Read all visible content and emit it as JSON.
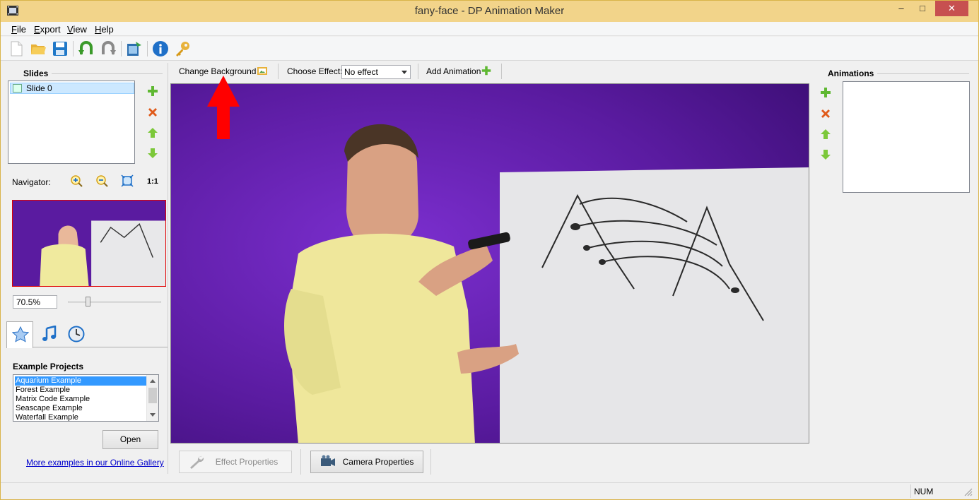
{
  "window": {
    "title": "fany-face - DP Animation Maker",
    "minimize": "–",
    "maximize": "□",
    "close": "✕"
  },
  "menu": [
    "File",
    "Export",
    "View",
    "Help"
  ],
  "toolbar": {
    "icons": [
      "new-file-icon",
      "open-folder-icon",
      "save-disk-icon",
      "undo-icon",
      "redo-icon",
      "export-video-icon",
      "info-icon",
      "key-icon"
    ]
  },
  "slides": {
    "title": "Slides",
    "items": [
      {
        "label": "Slide 0"
      }
    ]
  },
  "navigator": {
    "label": "Navigator:",
    "actual_size": "1:1",
    "zoom": "70.5%",
    "zoom_slider_percent": 25
  },
  "tabs": [
    "star-icon",
    "music-note-icon",
    "clock-icon"
  ],
  "examples": {
    "title": "Example Projects",
    "items": [
      "Aquarium Example",
      "Forest Example",
      "Matrix Code Example",
      "Seascape Example",
      "Waterfall Example"
    ],
    "selected": 0,
    "open_button": "Open",
    "gallery_link": "More examples in our Online Gallery"
  },
  "background_bar": {
    "change_background": "Change Background",
    "choose_effect_label": "Choose Effect:",
    "effect_value": "No effect",
    "add_animation": "Add Animation"
  },
  "properties": {
    "effect": "Effect Properties",
    "camera": "Camera Properties"
  },
  "animations": {
    "title": "Animations"
  },
  "status": {
    "num": "NUM"
  },
  "colors": {
    "title_bar": "#f2d48a",
    "close_button": "#c75050",
    "selection": "#3399ff",
    "annotation_arrow": "#ff0000",
    "backdrop_purple": "#5a1ba0"
  }
}
